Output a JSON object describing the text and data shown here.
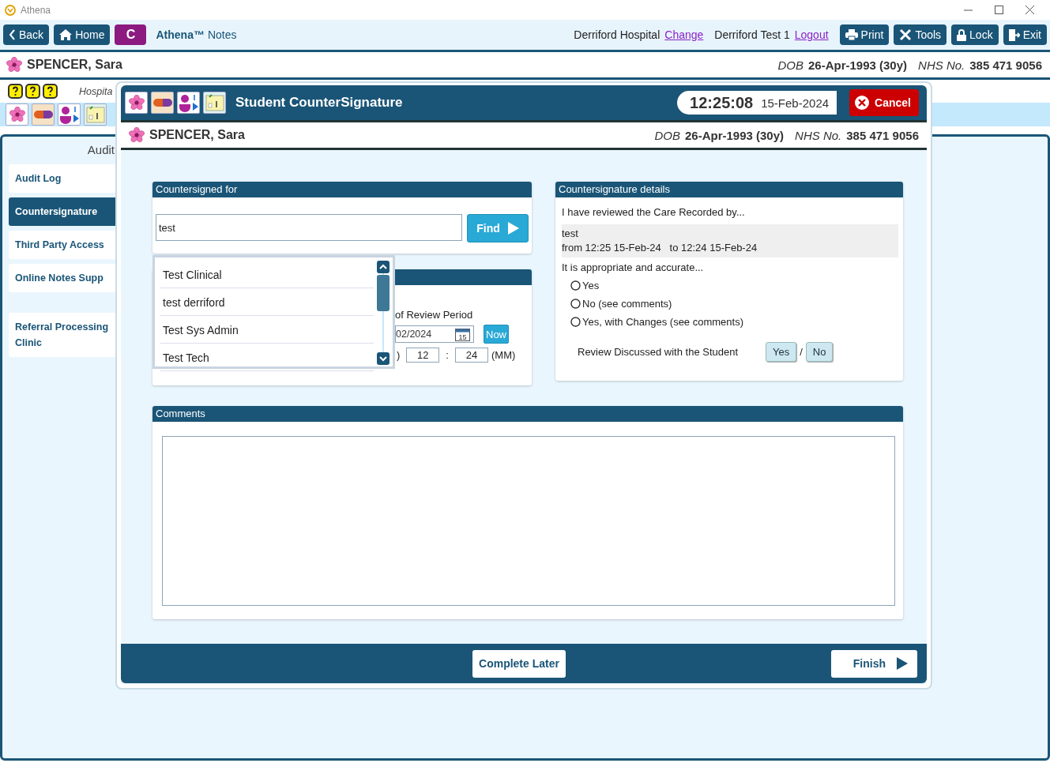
{
  "window": {
    "app_name": "Athena"
  },
  "toolbar": {
    "nav": [
      {
        "kind": "back",
        "label": "Back"
      },
      {
        "kind": "home",
        "label": "Home"
      },
      {
        "kind": "letter",
        "label": "C"
      }
    ],
    "app_title": "Athena™",
    "app_subtitle": "Notes",
    "site": "Derriford Hospital",
    "site_link": "Change",
    "user": "Derriford Test 1",
    "user_link": "Logout",
    "actions": [
      {
        "kind": "print",
        "label": "Print"
      },
      {
        "kind": "tools",
        "label": "Tools"
      },
      {
        "kind": "lock",
        "label": "Lock"
      },
      {
        "kind": "exit",
        "label": "Exit"
      }
    ]
  },
  "patient": {
    "name": "SPENCER, Sara",
    "dob_label": "DOB",
    "dob": "26-Apr-1993 (30y)",
    "nhs_label": "NHS No.",
    "nhs": "385 471 9056"
  },
  "background": {
    "hospital_label": "Hospita",
    "section_title": "Audit",
    "sidebar": [
      {
        "label": "Audit Log",
        "selected": false
      },
      {
        "label": "Countersignature",
        "selected": true
      },
      {
        "label": "Third Party Access",
        "selected": false
      },
      {
        "label": "Online Notes Supp",
        "selected": false
      },
      {
        "label": "Referral Processing Clinic",
        "selected": false
      }
    ]
  },
  "dialog": {
    "title": "Student CounterSignature",
    "time": "12:25:08",
    "date": "15-Feb-2024",
    "cancel": "Cancel",
    "patient": {
      "name": "SPENCER, Sara",
      "dob_label": "DOB",
      "dob": "26-Apr-1993 (30y)",
      "nhs_label": "NHS No.",
      "nhs": "385 471 9056"
    },
    "countersigned_for": {
      "title": "Countersigned for",
      "value": "test",
      "find": "Find"
    },
    "suggestions": [
      "Test Clinical",
      "test derriford",
      "Test Sys Admin",
      "Test Tech"
    ],
    "review_period": {
      "label": "of Review Period",
      "date": "02/2024",
      "calendar_day": "15",
      "now": "Now",
      "hour_suffix": ")",
      "hour": "12",
      "separator": ":",
      "minute": "24",
      "minute_label": "(MM)"
    },
    "details": {
      "title": "Countersignature details",
      "reviewed_label": "I have reviewed the Care Recorded by...",
      "recorded_name": "test",
      "recorded_range": "from 12:25 15-Feb-24   to 12:24 15-Feb-24",
      "accurate_label": "It is appropriate and accurate...",
      "options": [
        {
          "label": "Yes",
          "selected": false
        },
        {
          "label": "No (see comments)",
          "selected": false
        },
        {
          "label": "Yes, with Changes (see comments)",
          "selected": false
        }
      ],
      "discussed_label": "Review Discussed with the Student",
      "discussed_yes": "Yes",
      "discussed_separator": "/",
      "discussed_no": "No"
    },
    "comments": {
      "title": "Comments"
    },
    "footer": {
      "complete_later": "Complete Later",
      "finish": "Finish"
    }
  }
}
